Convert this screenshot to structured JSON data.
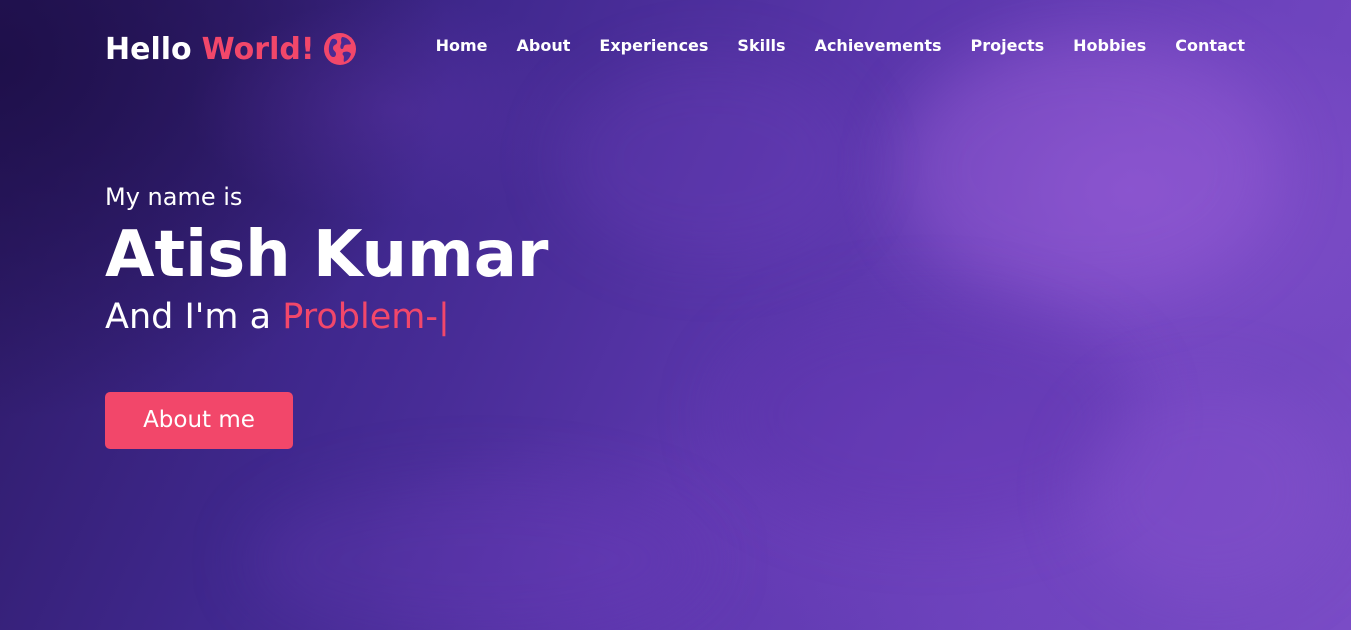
{
  "logo": {
    "text_white": "Hello",
    "text_accent": "World!",
    "icon": "globe-icon"
  },
  "nav": {
    "items": [
      {
        "label": "Home"
      },
      {
        "label": "About"
      },
      {
        "label": "Experiences"
      },
      {
        "label": "Skills"
      },
      {
        "label": "Achievements"
      },
      {
        "label": "Projects"
      },
      {
        "label": "Hobbies"
      },
      {
        "label": "Contact"
      }
    ]
  },
  "hero": {
    "greeting": "My name is",
    "name": "Atish Kumar",
    "role_prefix": "And I'm a",
    "role_typed": "Problem-",
    "cursor": "|",
    "button_label": "About me"
  },
  "colors": {
    "accent": "#f2476a",
    "text": "#ffffff",
    "background_dark": "#2a1860",
    "background_light": "#7a4cc6"
  }
}
